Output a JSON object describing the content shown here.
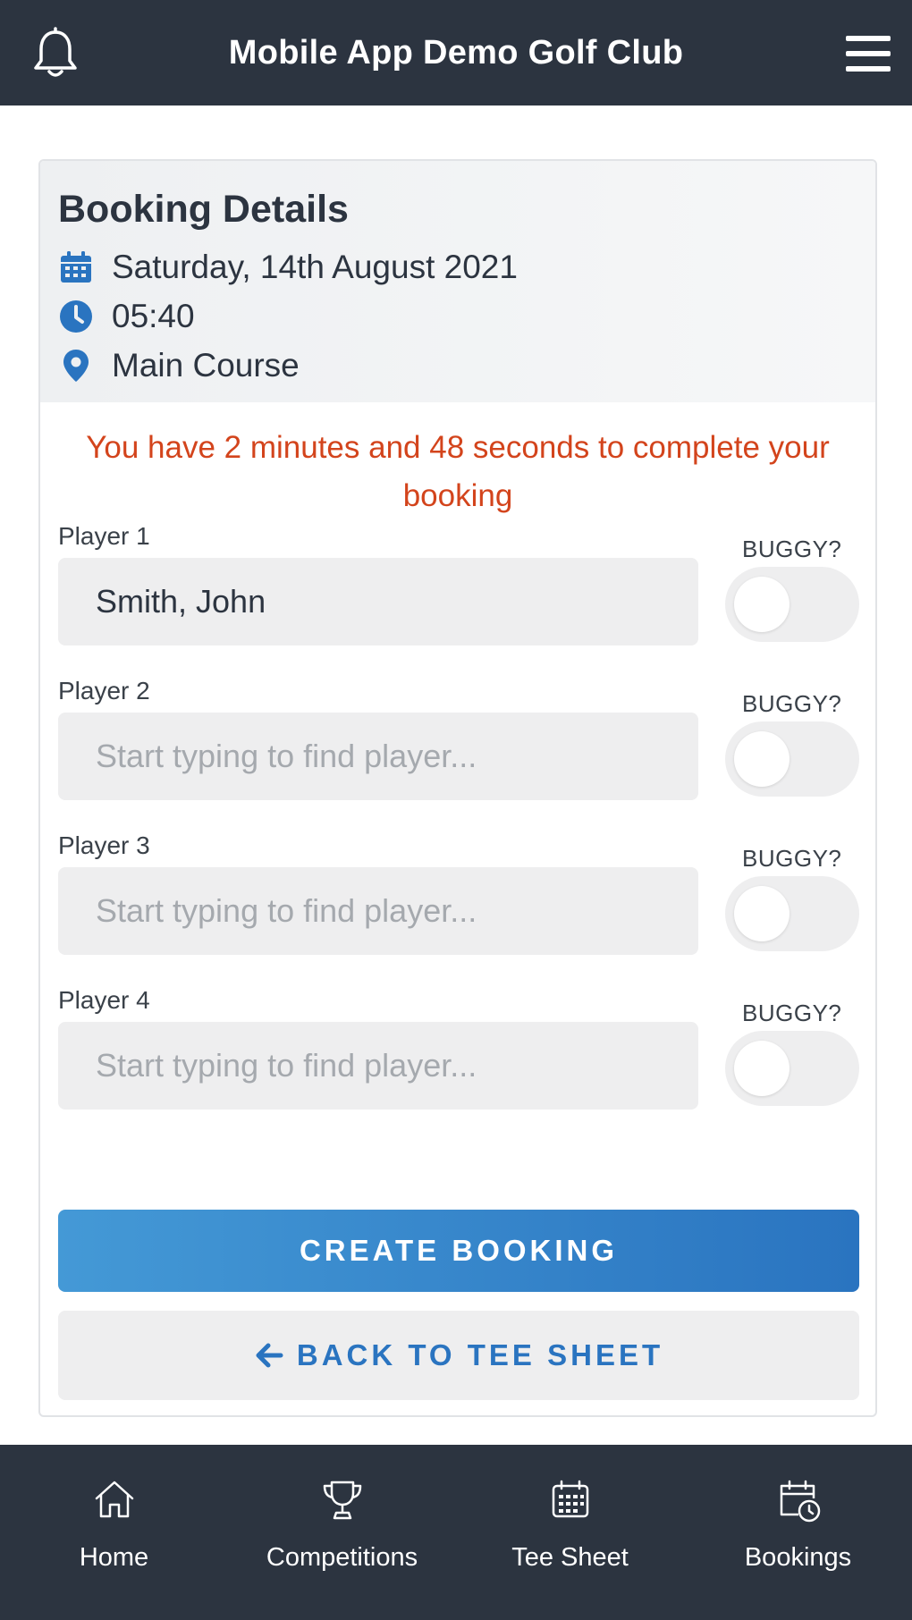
{
  "header": {
    "title": "Mobile App Demo Golf Club",
    "left_icon": "bell-icon",
    "right_icon": "hamburger-menu-icon"
  },
  "booking": {
    "heading": "Booking Details",
    "date": "Saturday, 14th August 2021",
    "time": "05:40",
    "course": "Main Course",
    "timer_message": "You have 2 minutes and 48 seconds to complete your booking"
  },
  "players": [
    {
      "label": "Player 1",
      "value": "Smith, John",
      "placeholder": "Start typing to find player...",
      "buggy_label": "BUGGY?",
      "buggy": false
    },
    {
      "label": "Player 2",
      "value": "",
      "placeholder": "Start typing to find player...",
      "buggy_label": "BUGGY?",
      "buggy": false
    },
    {
      "label": "Player 3",
      "value": "",
      "placeholder": "Start typing to find player...",
      "buggy_label": "BUGGY?",
      "buggy": false
    },
    {
      "label": "Player 4",
      "value": "",
      "placeholder": "Start typing to find player...",
      "buggy_label": "BUGGY?",
      "buggy": false
    }
  ],
  "actions": {
    "create_label": "CREATE BOOKING",
    "back_label": "BACK TO TEE SHEET"
  },
  "tabs": [
    {
      "label": "Home",
      "icon": "home-icon"
    },
    {
      "label": "Competitions",
      "icon": "trophy-icon"
    },
    {
      "label": "Tee Sheet",
      "icon": "calendar-grid-icon"
    },
    {
      "label": "Bookings",
      "icon": "calendar-clock-icon"
    }
  ],
  "colors": {
    "header_bg": "#2c3440",
    "accent_blue": "#2a74c0",
    "timer_red": "#d3441c",
    "field_bg": "#eeeeef"
  }
}
